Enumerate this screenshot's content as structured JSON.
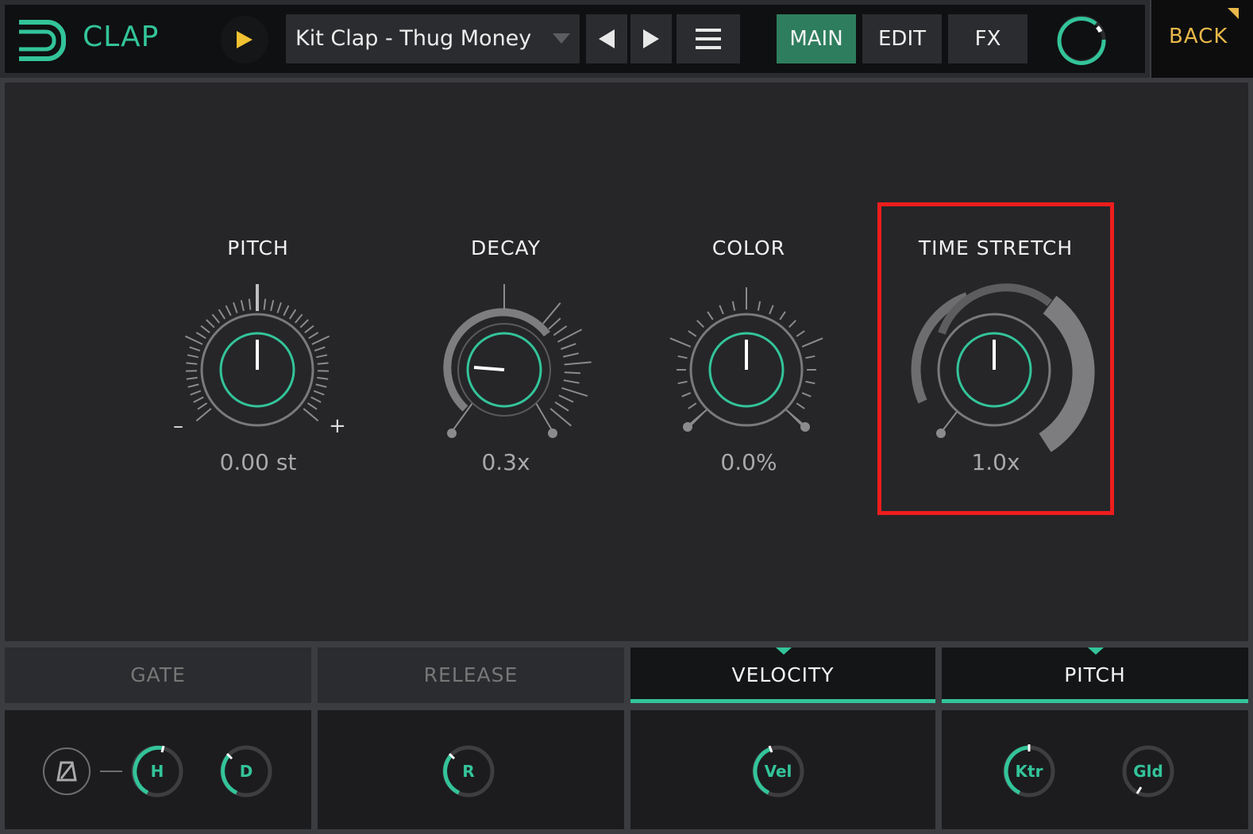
{
  "header": {
    "app_title": "CLAP",
    "preset_name": "Kit Clap - Thug Money",
    "tabs": [
      {
        "label": "MAIN",
        "active": true
      },
      {
        "label": "EDIT",
        "active": false
      },
      {
        "label": "FX",
        "active": false
      }
    ],
    "back_label": "BACK"
  },
  "colors": {
    "accent": "#33c49a",
    "tab_active": "#2e7d5f",
    "back_text": "#e9b84a",
    "play": "#f1c232",
    "highlight": "#ee1d1d"
  },
  "knobs": [
    {
      "label": "PITCH",
      "value": "0.00 st",
      "min_label": "–",
      "max_label": "+"
    },
    {
      "label": "DECAY",
      "value": "0.3x"
    },
    {
      "label": "COLOR",
      "value": "0.0%"
    },
    {
      "label": "TIME STRETCH",
      "value": "1.0x"
    }
  ],
  "bottom_tabs": [
    {
      "label": "GATE",
      "active": false
    },
    {
      "label": "RELEASE",
      "active": false
    },
    {
      "label": "VELOCITY",
      "active": true
    },
    {
      "label": "PITCH",
      "active": true
    }
  ],
  "mini_knobs": {
    "hold": "H",
    "decay": "D",
    "release": "R",
    "velocity": "Vel",
    "keytrack": "Ktr",
    "glide": "Gld"
  },
  "icons": [
    "logo-icon",
    "play-icon",
    "dropdown-arrow-icon",
    "prev-icon",
    "next-icon",
    "menu-icon",
    "level-meter-icon",
    "corner-flag-icon",
    "metronome-icon"
  ]
}
